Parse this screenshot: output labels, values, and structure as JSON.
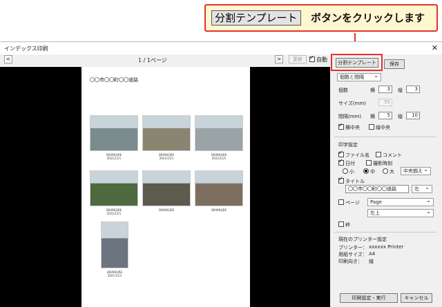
{
  "callout": {
    "button_label": "分割テンプレート",
    "text": "ボタンをクリックします"
  },
  "window": {
    "title": "インデックス印刷",
    "close_glyph": "✕"
  },
  "toolbar": {
    "prev_glyph": "<",
    "next_glyph": ">",
    "page_info": "1 / 1ページ",
    "update_label": "更新",
    "auto_label": "自動"
  },
  "preview": {
    "page_title": "〇〇市〇〇町〇〇道路",
    "thumbnails": [
      {
        "caption1": "D60981JRE",
        "caption2": "2021/11/1",
        "color": "#7b8a8c"
      },
      {
        "caption1": "D60981JRE",
        "caption2": "2021/11/1",
        "color": "#8a8570"
      },
      {
        "caption1": "D60981JRE",
        "caption2": "2021/11/1",
        "color": "#9aa3a6"
      },
      {
        "caption1": "D60981JRE",
        "caption2": "2021/11/1",
        "color": "#4f6a3e"
      },
      {
        "caption1": "D60981JRE",
        "caption2": "",
        "color": "#5e5a4e"
      },
      {
        "caption1": "D60981JRE",
        "caption2": "",
        "color": "#7d6f5f"
      },
      {
        "caption1": "D60981JRE",
        "caption2": "2021/11/1",
        "color": "#6c7480"
      }
    ]
  },
  "panel": {
    "template_button": "分割テンプレート",
    "save_button": "保存",
    "layout_mode": "個数と間隔",
    "count_label": "個数",
    "yoko_label": "横",
    "tate_label": "縦",
    "count_x": "3",
    "count_y": "3",
    "size_label": "サイズ(mm)",
    "size_value": "55",
    "gap_label": "間隔(mm)",
    "gap_x": "5",
    "gap_y": "10",
    "h_center": "横中央",
    "v_center": "縦中央",
    "print_settings": "印字設定",
    "filename": "ファイル名",
    "comment": "コメント",
    "date": "日付",
    "shot_time": "撮影時刻",
    "size_small": "小",
    "size_medium": "中",
    "size_large": "大",
    "align_select": "中央揃え",
    "title_check": "タイトル",
    "title_value": "〇〇市〇〇町〇〇道路",
    "title_pos": "左",
    "page_check": "ページ",
    "page_format": "Page",
    "page_pos": "左上",
    "frame_check": "枠",
    "printer_section": "現在のプリンター設定",
    "printer_label": "プリンター：",
    "printer_value": "xxxxxx Printer",
    "paper_label": "用紙サイズ：",
    "paper_value": "A4",
    "orient_label": "印刷向き：",
    "orient_value": "縦",
    "print_button": "印刷設定・実行",
    "cancel_button": "キャンセル"
  }
}
